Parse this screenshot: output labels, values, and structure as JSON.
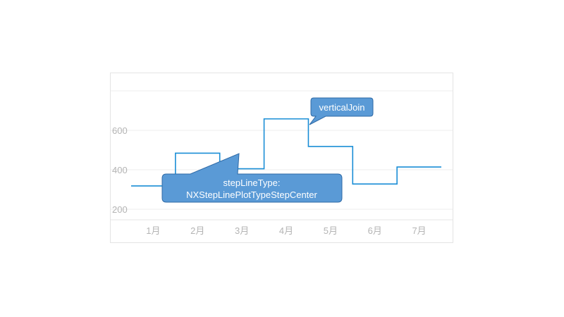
{
  "chart_data": {
    "type": "line",
    "step_mode": "center",
    "categories": [
      "1月",
      "2月",
      "3月",
      "4月",
      "5月",
      "6月",
      "7月"
    ],
    "series": [
      {
        "values": [
          318,
          484,
          405,
          658,
          518,
          328,
          414
        ],
        "color": "#1a8ed6"
      }
    ],
    "yticks": [
      200,
      400,
      600
    ],
    "ylim": [
      0,
      800
    ],
    "grid": true,
    "annotations": [
      {
        "id": "vertical-join",
        "lines": [
          "verticalJoin"
        ]
      },
      {
        "id": "step-type",
        "lines": [
          "stepLineType:",
          "NXStepLinePlotTypeStepCenter"
        ]
      }
    ]
  }
}
